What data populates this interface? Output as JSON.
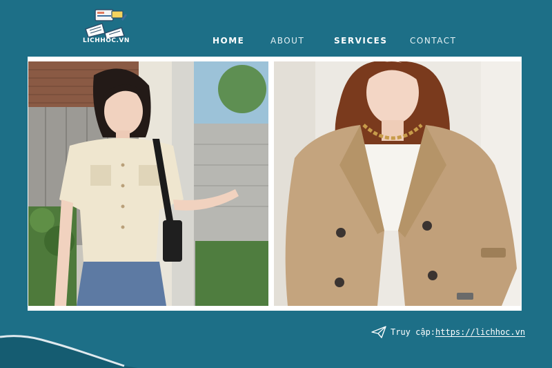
{
  "logo": {
    "text": "LICHHOC.VN",
    "icon": "open-book-logo-icon"
  },
  "nav": {
    "items": [
      {
        "label": "HOME",
        "bold": true
      },
      {
        "label": "ABOUT",
        "bold": false
      },
      {
        "label": "SERVICES",
        "bold": true
      },
      {
        "label": "CONTACT",
        "bold": false
      }
    ]
  },
  "photos": {
    "left": {
      "icon": "photo-cream-knit-cardigan"
    },
    "right": {
      "icon": "photo-beige-trench-blazer"
    }
  },
  "footer": {
    "icon": "paper-plane-icon",
    "prefix": "Truy cập: ",
    "url": "https://lichhoc.vn"
  },
  "colors": {
    "background": "#1d6f87",
    "frame": "#ffffff",
    "text": "#ffffff"
  }
}
